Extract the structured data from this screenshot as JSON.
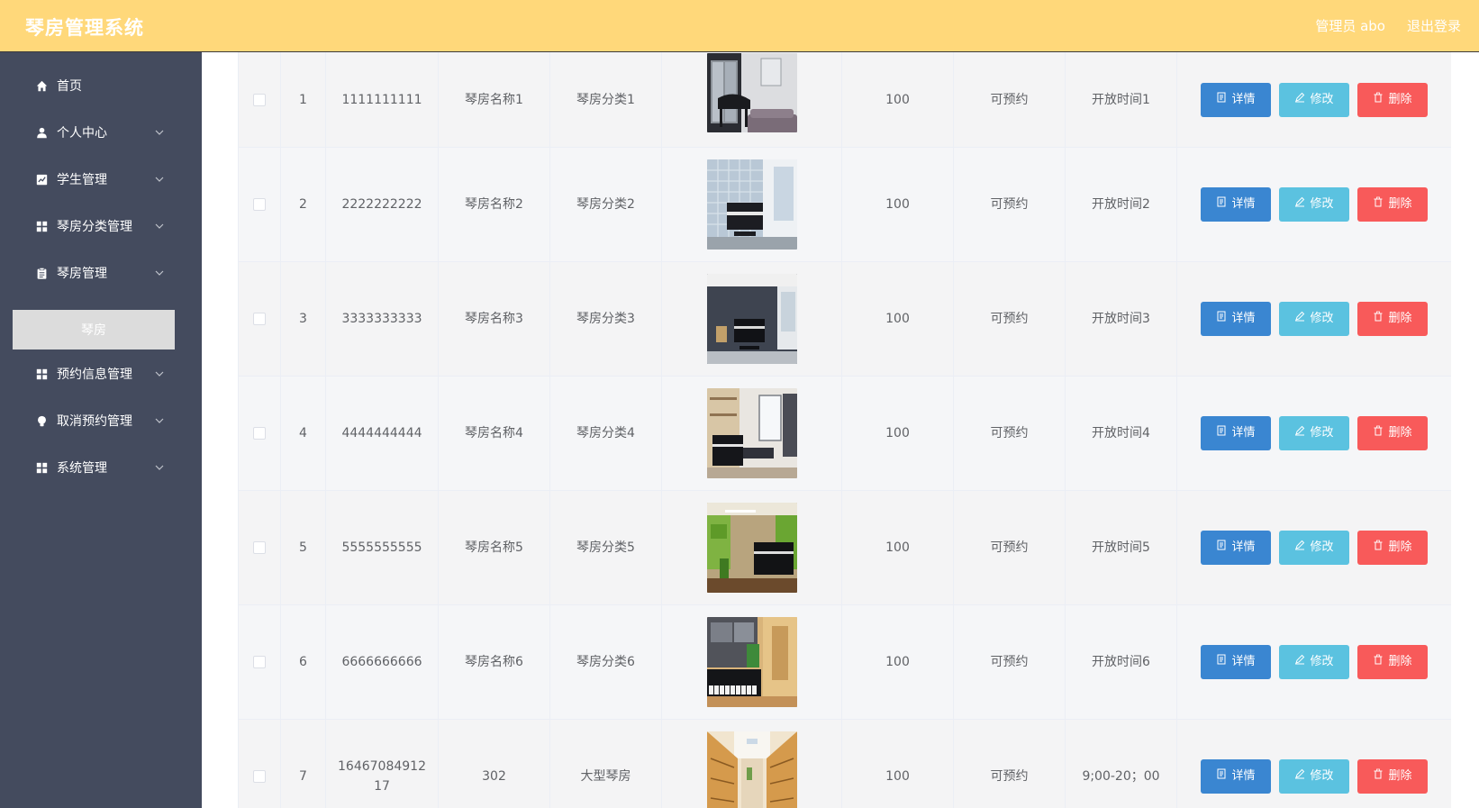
{
  "header": {
    "title": "琴房管理系统",
    "user_label": "管理员 abo",
    "logout_label": "退出登录",
    "bg_color": "#ffd87a"
  },
  "sidebar": {
    "bg_color": "#444b5e",
    "items": [
      {
        "label": "首页",
        "icon": "home-icon",
        "has_children": false
      },
      {
        "label": "个人中心",
        "icon": "user-icon",
        "has_children": true
      },
      {
        "label": "学生管理",
        "icon": "chart-icon",
        "has_children": true
      },
      {
        "label": "琴房分类管理",
        "icon": "grid-icon",
        "has_children": true
      },
      {
        "label": "琴房管理",
        "icon": "clipboard-icon",
        "has_children": true
      },
      {
        "label": "预约信息管理",
        "icon": "grid-icon",
        "has_children": true
      },
      {
        "label": "取消预约管理",
        "icon": "bulb-icon",
        "has_children": true
      },
      {
        "label": "系统管理",
        "icon": "grid-icon",
        "has_children": true
      }
    ],
    "active_sub_item": "琴房"
  },
  "table": {
    "buttons": {
      "detail": "详情",
      "edit": "修改",
      "delete": "删除"
    },
    "rows": [
      {
        "index": "1",
        "number": "1111111111",
        "name": "琴房名称1",
        "category": "琴房分类1",
        "price": "100",
        "status": "可预约",
        "open_time": "开放时间1",
        "image": "piano-room-living"
      },
      {
        "index": "2",
        "number": "2222222222",
        "name": "琴房名称2",
        "category": "琴房分类2",
        "price": "100",
        "status": "可预约",
        "open_time": "开放时间2",
        "image": "piano-room-glass"
      },
      {
        "index": "3",
        "number": "3333333333",
        "name": "琴房名称3",
        "category": "琴房分类3",
        "price": "100",
        "status": "可预约",
        "open_time": "开放时间3",
        "image": "piano-room-dark"
      },
      {
        "index": "4",
        "number": "4444444444",
        "name": "琴房名称4",
        "category": "琴房分类4",
        "price": "100",
        "status": "可预约",
        "open_time": "开放时间4",
        "image": "piano-room-study"
      },
      {
        "index": "5",
        "number": "5555555555",
        "name": "琴房名称5",
        "category": "琴房分类5",
        "price": "100",
        "status": "可预约",
        "open_time": "开放时间5",
        "image": "piano-room-green"
      },
      {
        "index": "6",
        "number": "6666666666",
        "name": "琴房名称6",
        "category": "琴房分类6",
        "price": "100",
        "status": "可预约",
        "open_time": "开放时间6",
        "image": "piano-room-wood"
      },
      {
        "index": "7",
        "number": "1646708491217",
        "name": "302",
        "category": "大型琴房",
        "price": "100",
        "status": "可预约",
        "open_time": "9;00-20；00",
        "image": "practice-hall"
      }
    ]
  }
}
